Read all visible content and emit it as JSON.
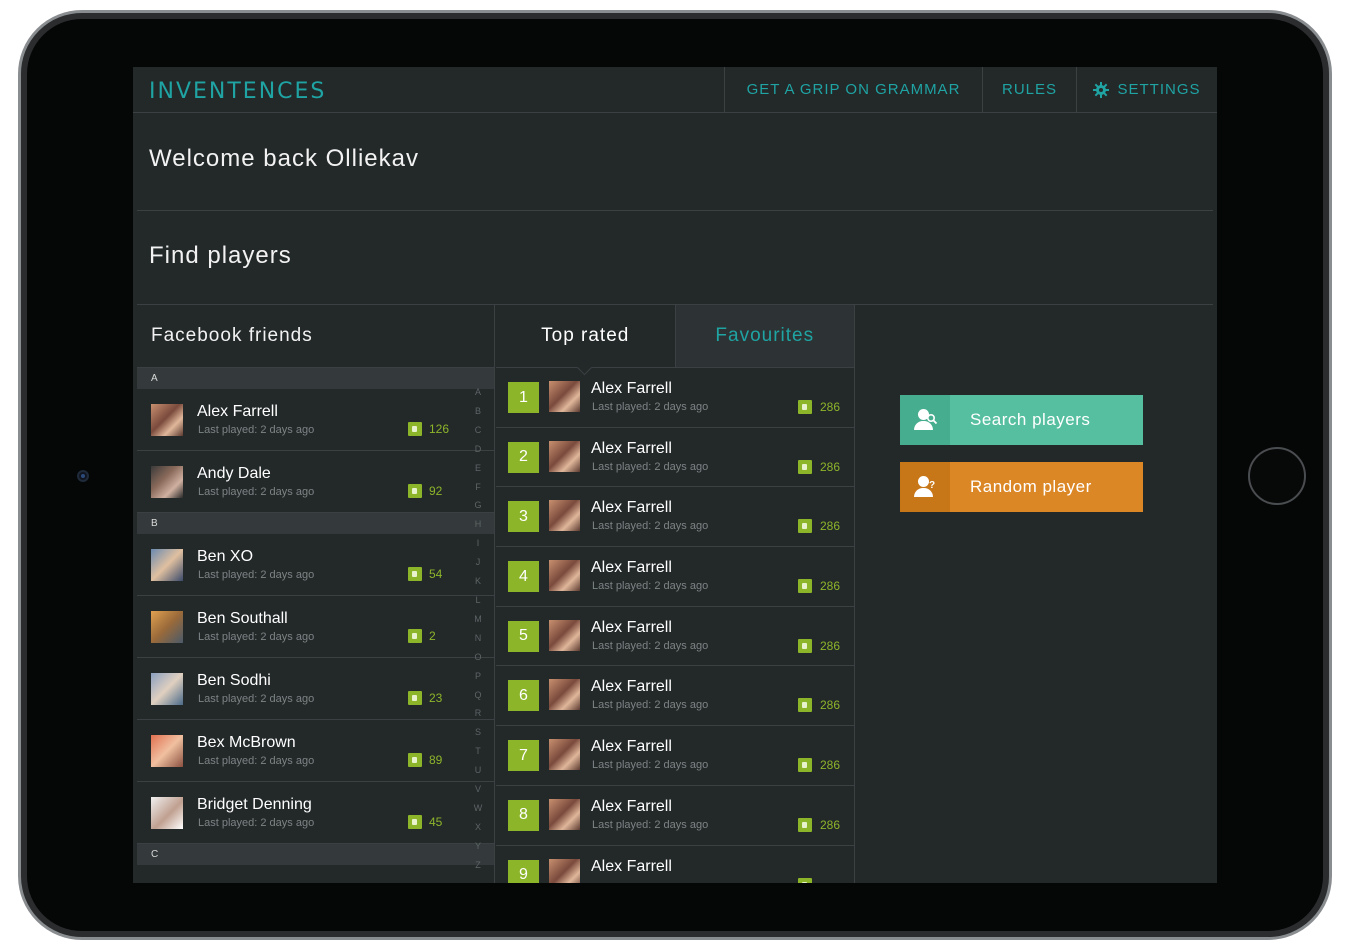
{
  "app": {
    "logo": "INVENTENCES",
    "nav": {
      "grammar": "GET A GRIP ON GRAMMAR",
      "rules": "RULES",
      "settings": "SETTINGS"
    }
  },
  "welcome": "Welcome back Olliekav",
  "find_players": "Find players",
  "facebook": {
    "title": "Facebook friends",
    "sections": [
      {
        "letter": "A",
        "friends": [
          {
            "name": "Alex Farrell",
            "last": "Last played: 2 days ago",
            "score": "126"
          },
          {
            "name": "Andy Dale",
            "last": "Last played: 2 days ago",
            "score": "92"
          }
        ]
      },
      {
        "letter": "B",
        "friends": [
          {
            "name": "Ben XO",
            "last": "Last played: 2 days ago",
            "score": "54"
          },
          {
            "name": "Ben Southall",
            "last": "Last played: 2 days ago",
            "score": "2"
          },
          {
            "name": "Ben Sodhi",
            "last": "Last played: 2 days ago",
            "score": "23"
          },
          {
            "name": "Bex McBrown",
            "last": "Last played: 2 days ago",
            "score": "89"
          },
          {
            "name": "Bridget Denning",
            "last": "Last played: 2 days ago",
            "score": "45"
          }
        ]
      },
      {
        "letter": "C",
        "friends": []
      }
    ],
    "alphabet": [
      "A",
      "B",
      "C",
      "D",
      "E",
      "F",
      "G",
      "H",
      "I",
      "J",
      "K",
      "L",
      "M",
      "N",
      "O",
      "P",
      "Q",
      "R",
      "S",
      "T",
      "U",
      "V",
      "W",
      "X",
      "Y",
      "Z"
    ]
  },
  "tabs": {
    "top_rated": "Top rated",
    "favourites": "Favourites"
  },
  "top_rated": [
    {
      "rank": "1",
      "name": "Alex Farrell",
      "last": "Last played: 2 days ago",
      "score": "286"
    },
    {
      "rank": "2",
      "name": "Alex Farrell",
      "last": "Last played: 2 days ago",
      "score": "286"
    },
    {
      "rank": "3",
      "name": "Alex Farrell",
      "last": "Last played: 2 days ago",
      "score": "286"
    },
    {
      "rank": "4",
      "name": "Alex Farrell",
      "last": "Last played: 2 days ago",
      "score": "286"
    },
    {
      "rank": "5",
      "name": "Alex Farrell",
      "last": "Last played: 2 days ago",
      "score": "286"
    },
    {
      "rank": "6",
      "name": "Alex Farrell",
      "last": "Last played: 2 days ago",
      "score": "286"
    },
    {
      "rank": "7",
      "name": "Alex Farrell",
      "last": "Last played: 2 days ago",
      "score": "286"
    },
    {
      "rank": "8",
      "name": "Alex Farrell",
      "last": "Last played: 2 days ago",
      "score": "286"
    },
    {
      "rank": "9",
      "name": "Alex Farrell",
      "last": "",
      "score": ""
    }
  ],
  "actions": {
    "search": "Search players",
    "random": "Random player"
  },
  "colors": {
    "accent": "#1fa3a3",
    "score_green": "#8db52a",
    "search_button": "#55bfa0",
    "random_button": "#dc8726",
    "background": "#232829"
  },
  "icons": {
    "settings": "gear-icon",
    "score": "thumbs-up-icon",
    "search": "person-search-icon",
    "random": "person-question-icon"
  }
}
